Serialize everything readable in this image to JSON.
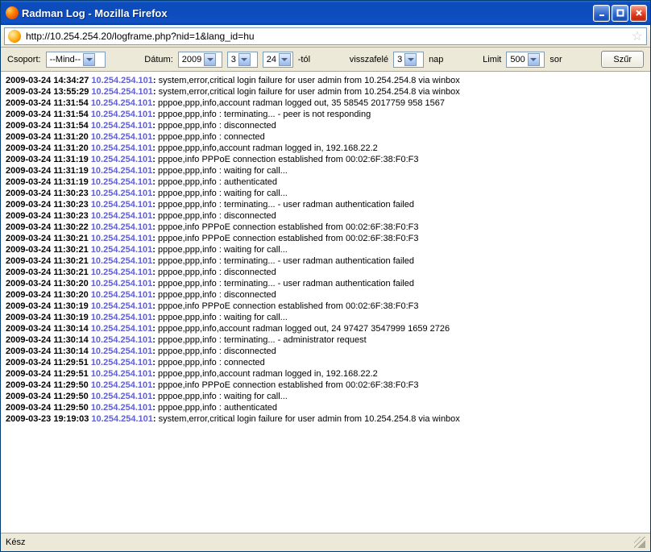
{
  "window": {
    "title": "Radman Log - Mozilla Firefox"
  },
  "address": {
    "url": "http://10.254.254.20/logframe.php?nid=1&lang_id=hu"
  },
  "filter": {
    "group_label": "Csoport:",
    "group_value": "--Mind--",
    "date_label": "Dátum:",
    "year": "2009",
    "month": "3",
    "day": "24",
    "from_suffix": "-tól",
    "back_label": "visszafelé",
    "back_value": "3",
    "day_unit": "nap",
    "limit_label": "Limit",
    "limit_value": "500",
    "row_unit": "sor",
    "filter_btn": "Szűr"
  },
  "logs": [
    {
      "ts": "2009-03-24 14:34:27",
      "ip": "10.254.254.101",
      "msg": "system,error,critical login failure for user admin from 10.254.254.8 via winbox"
    },
    {
      "ts": "2009-03-24 13:55:29",
      "ip": "10.254.254.101",
      "msg": "system,error,critical login failure for user admin from 10.254.254.8 via winbox"
    },
    {
      "ts": "2009-03-24 11:31:54",
      "ip": "10.254.254.101",
      "msg": "pppoe,ppp,info,account radman logged out, 35 58545 2017759 958 1567"
    },
    {
      "ts": "2009-03-24 11:31:54",
      "ip": "10.254.254.101",
      "msg": "pppoe,ppp,info : terminating... - peer is not responding"
    },
    {
      "ts": "2009-03-24 11:31:54",
      "ip": "10.254.254.101",
      "msg": "pppoe,ppp,info : disconnected"
    },
    {
      "ts": "2009-03-24 11:31:20",
      "ip": "10.254.254.101",
      "msg": "pppoe,ppp,info : connected"
    },
    {
      "ts": "2009-03-24 11:31:20",
      "ip": "10.254.254.101",
      "msg": "pppoe,ppp,info,account radman logged in, 192.168.22.2"
    },
    {
      "ts": "2009-03-24 11:31:19",
      "ip": "10.254.254.101",
      "msg": "pppoe,info PPPoE connection established from 00:02:6F:38:F0:F3"
    },
    {
      "ts": "2009-03-24 11:31:19",
      "ip": "10.254.254.101",
      "msg": "pppoe,ppp,info : waiting for call..."
    },
    {
      "ts": "2009-03-24 11:31:19",
      "ip": "10.254.254.101",
      "msg": "pppoe,ppp,info : authenticated"
    },
    {
      "ts": "2009-03-24 11:30:23",
      "ip": "10.254.254.101",
      "msg": "pppoe,ppp,info : waiting for call..."
    },
    {
      "ts": "2009-03-24 11:30:23",
      "ip": "10.254.254.101",
      "msg": "pppoe,ppp,info : terminating... - user radman authentication failed"
    },
    {
      "ts": "2009-03-24 11:30:23",
      "ip": "10.254.254.101",
      "msg": "pppoe,ppp,info : disconnected"
    },
    {
      "ts": "2009-03-24 11:30:22",
      "ip": "10.254.254.101",
      "msg": "pppoe,info PPPoE connection established from 00:02:6F:38:F0:F3"
    },
    {
      "ts": "2009-03-24 11:30:21",
      "ip": "10.254.254.101",
      "msg": "pppoe,info PPPoE connection established from 00:02:6F:38:F0:F3"
    },
    {
      "ts": "2009-03-24 11:30:21",
      "ip": "10.254.254.101",
      "msg": "pppoe,ppp,info : waiting for call..."
    },
    {
      "ts": "2009-03-24 11:30:21",
      "ip": "10.254.254.101",
      "msg": "pppoe,ppp,info : terminating... - user radman authentication failed"
    },
    {
      "ts": "2009-03-24 11:30:21",
      "ip": "10.254.254.101",
      "msg": "pppoe,ppp,info : disconnected"
    },
    {
      "ts": "2009-03-24 11:30:20",
      "ip": "10.254.254.101",
      "msg": "pppoe,ppp,info : terminating... - user radman authentication failed"
    },
    {
      "ts": "2009-03-24 11:30:20",
      "ip": "10.254.254.101",
      "msg": "pppoe,ppp,info : disconnected"
    },
    {
      "ts": "2009-03-24 11:30:19",
      "ip": "10.254.254.101",
      "msg": "pppoe,info PPPoE connection established from 00:02:6F:38:F0:F3"
    },
    {
      "ts": "2009-03-24 11:30:19",
      "ip": "10.254.254.101",
      "msg": "pppoe,ppp,info : waiting for call..."
    },
    {
      "ts": "2009-03-24 11:30:14",
      "ip": "10.254.254.101",
      "msg": "pppoe,ppp,info,account radman logged out, 24 97427 3547999 1659 2726"
    },
    {
      "ts": "2009-03-24 11:30:14",
      "ip": "10.254.254.101",
      "msg": "pppoe,ppp,info : terminating... - administrator request"
    },
    {
      "ts": "2009-03-24 11:30:14",
      "ip": "10.254.254.101",
      "msg": "pppoe,ppp,info : disconnected"
    },
    {
      "ts": "2009-03-24 11:29:51",
      "ip": "10.254.254.101",
      "msg": "pppoe,ppp,info : connected"
    },
    {
      "ts": "2009-03-24 11:29:51",
      "ip": "10.254.254.101",
      "msg": "pppoe,ppp,info,account radman logged in, 192.168.22.2"
    },
    {
      "ts": "2009-03-24 11:29:50",
      "ip": "10.254.254.101",
      "msg": "pppoe,info PPPoE connection established from 00:02:6F:38:F0:F3"
    },
    {
      "ts": "2009-03-24 11:29:50",
      "ip": "10.254.254.101",
      "msg": "pppoe,ppp,info : waiting for call..."
    },
    {
      "ts": "2009-03-24 11:29:50",
      "ip": "10.254.254.101",
      "msg": "pppoe,ppp,info : authenticated"
    },
    {
      "ts": "2009-03-23 19:19:03",
      "ip": "10.254.254.101",
      "msg": "system,error,critical login failure for user admin from 10.254.254.8 via winbox"
    }
  ],
  "status": {
    "text": "Kész"
  }
}
